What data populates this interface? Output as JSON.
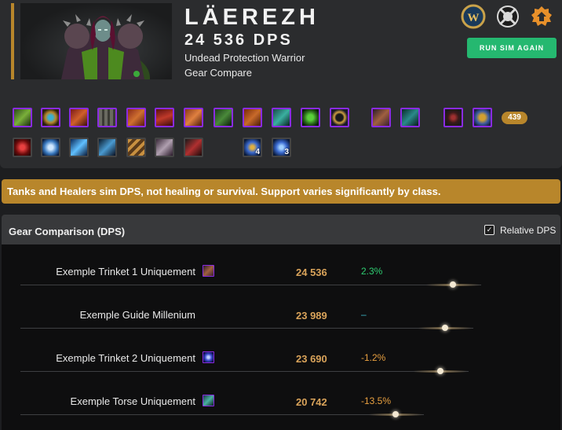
{
  "character": {
    "name": "LÄEREZH",
    "dps": "24 536 DPS",
    "spec": "Undead Protection Warrior",
    "report_type": "Gear Compare"
  },
  "header_icons": [
    "wow-logo-icon",
    "pvp-faction-icon",
    "simc-logo-icon"
  ],
  "run_button_label": "RUN SIM AGAIN",
  "gear": {
    "item_level": "439",
    "stack_counts": [
      "4",
      "3"
    ]
  },
  "notice": "Tanks and Healers sim DPS, not healing or survival. Support varies significantly by class.",
  "comparison": {
    "title": "Gear Comparison (DPS)",
    "toggle_label": "Relative DPS",
    "toggle_checked": true,
    "rows": [
      {
        "label": "Exemple Trinket 1 Uniquement",
        "dps": "24 536",
        "diff": "2.3%",
        "diff_color": "#2ecc71",
        "rel": 1.0
      },
      {
        "label": "Exemple Guide Millenium",
        "dps": "23 989",
        "diff": "–",
        "diff_color": "#3db8c8",
        "rel": 0.978
      },
      {
        "label": "Exemple Trinket 2 Uniquement",
        "dps": "23 690",
        "diff": "-1.2%",
        "diff_color": "#e8a040",
        "rel": 0.966
      },
      {
        "label": "Exemple Torse Uniquement",
        "dps": "20 742",
        "diff": "-13.5%",
        "diff_color": "#e8a040",
        "rel": 0.845
      }
    ]
  },
  "colors": {
    "accent": "#b8862b",
    "button": "#25b870",
    "epic_border": "#8a2be2",
    "dps_text": "#d9a35a"
  }
}
